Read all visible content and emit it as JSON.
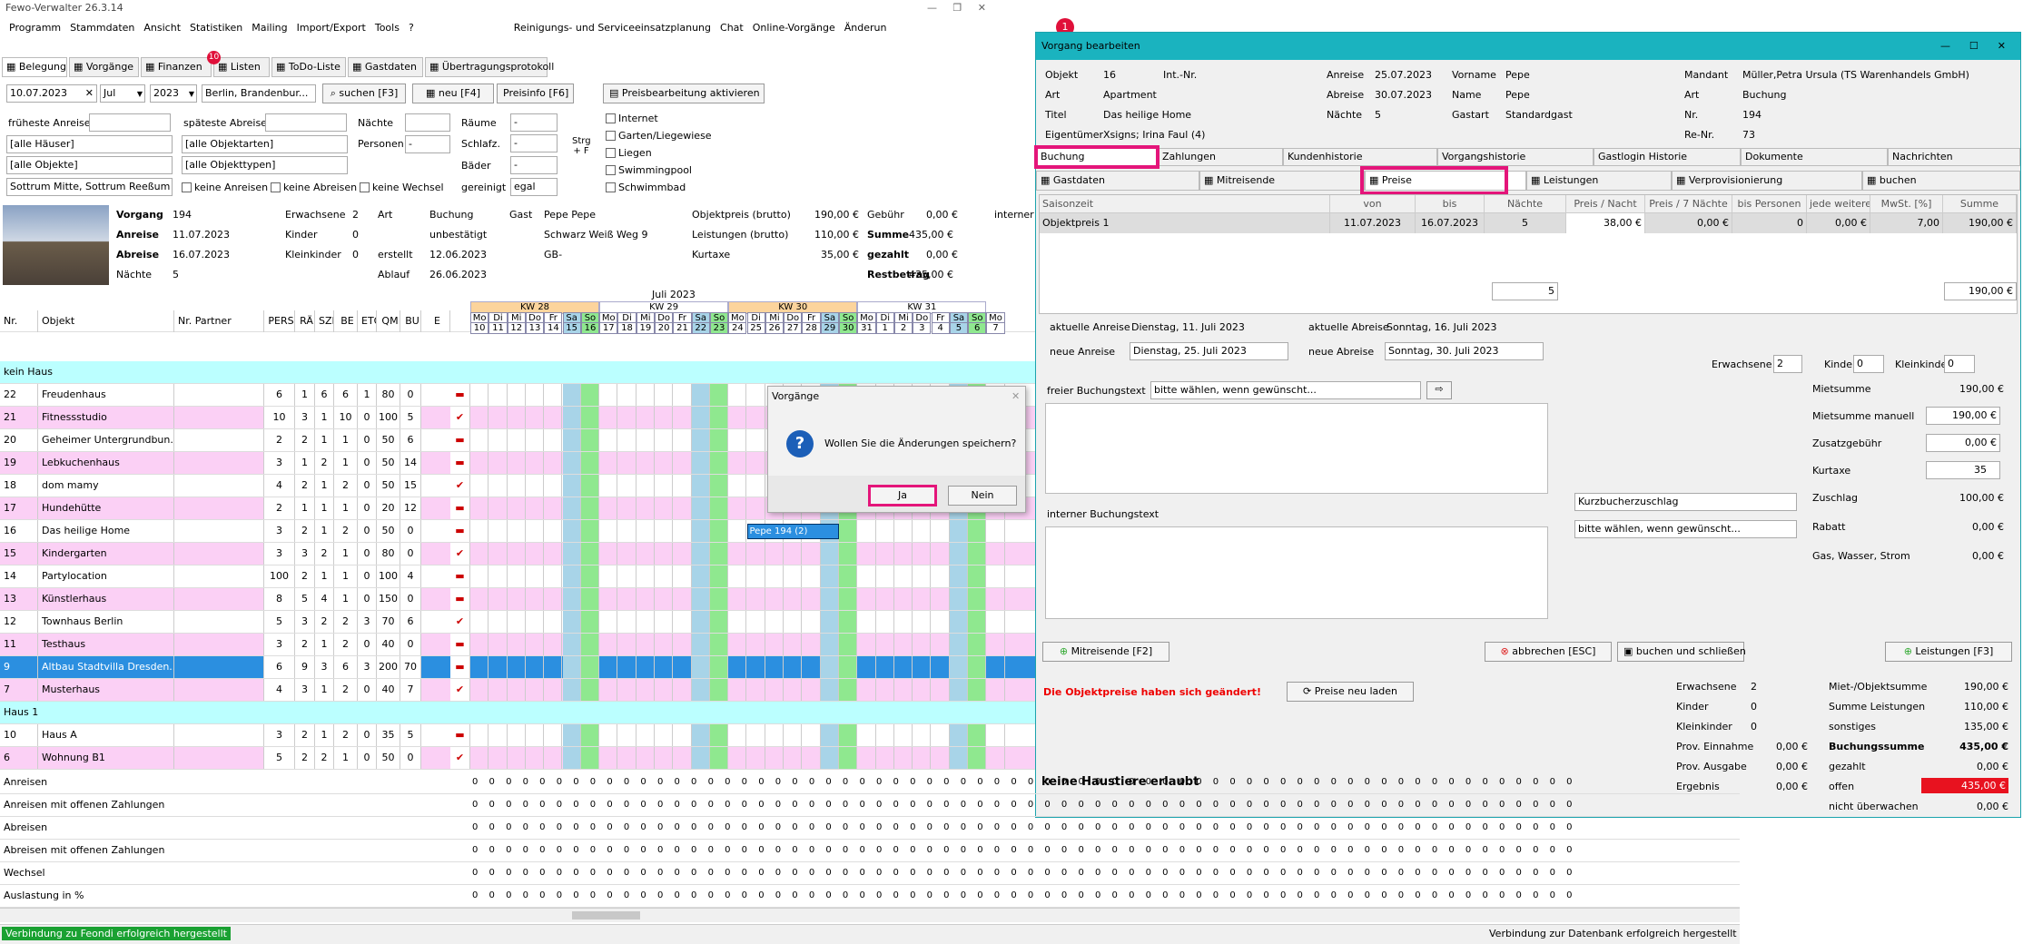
{
  "title": "Fewo-Verwalter 26.3.14",
  "menu": [
    "Programm",
    "Stammdaten",
    "Ansicht",
    "Statistiken",
    "Mailing",
    "Import/Export",
    "Tools",
    "?",
    "Reinigungs- und Serviceeinsatzplanung",
    "Chat",
    "Online-Vorgänge",
    "Änderun"
  ],
  "tabs": [
    "Belegung",
    "Vorgänge",
    "Finanzen",
    "Listen",
    "ToDo-Liste",
    "Gastdaten",
    "Übertragungsprotokoll"
  ],
  "badge_finanzen": "10",
  "badge_top": "1",
  "filter": {
    "date": "10.07.2023",
    "month": "Jul",
    "year": "2023",
    "region": "Berlin, Brandenbur...",
    "search": "suchen [F3]",
    "new": "neu [F4]",
    "preisinfo": "Preisinfo [F6]",
    "preisbearbeitung": "Preisbearbeitung aktivieren",
    "frueheste": "früheste Anreise",
    "spaeteste": "späteste Abreise",
    "naechte": "Nächte",
    "raeume": "Räume",
    "schlafz": "Schlafz.",
    "baeder": "Bäder",
    "personen": "Personen",
    "gereinigt": "gereinigt",
    "gereinigt_val": "egal",
    "strg": "Strg + F",
    "haeuser": "[alle Häuser]",
    "objektarten": "[alle Objektarten]",
    "objekte": "[alle Objekte]",
    "objekttypen": "[alle Objekttypen]",
    "ort": "Sottrum Mitte, Sottrum Reeßum",
    "keine_anreisen": "keine Anreisen",
    "keine_abreisen": "keine Abreisen",
    "keine_wechsel": "keine Wechsel",
    "features": [
      "Internet",
      "Garten/Liegewiese",
      "Liegen",
      "Swimmingpool",
      "Schwimmbad"
    ]
  },
  "info": {
    "vorgang_l": "Vorgang",
    "vorgang": "194",
    "anreise_l": "Anreise",
    "anreise": "11.07.2023",
    "abreise_l": "Abreise",
    "abreise": "16.07.2023",
    "naechte_l": "Nächte",
    "naechte": "5",
    "erw_l": "Erwachsene",
    "erw": "2",
    "kinder_l": "Kinder",
    "kinder": "0",
    "kk_l": "Kleinkinder",
    "kk": "0",
    "art_l": "Art",
    "art": "Buchung",
    "status": "unbestätigt",
    "erstellt_l": "erstellt",
    "erstellt": "12.06.2023",
    "ablauf_l": "Ablauf",
    "ablauf": "26.06.2023",
    "gast_l": "Gast",
    "gast": "Pepe  Pepe",
    "strasse": "Schwarz Weiß Weg 9",
    "land": "GB-",
    "objpreis_l": "Objektpreis (brutto)",
    "objpreis": "190,00 €",
    "leist_l": "Leistungen (brutto)",
    "leist": "110,00 €",
    "kurtaxe_l": "Kurtaxe",
    "kurtaxe": "35,00 €",
    "gebuehr_l": "Gebühr",
    "gebuehr": "0,00 €",
    "summe_l": "Summe",
    "summe": "435,00 €",
    "gezahlt_l": "gezahlt",
    "gezahlt": "0,00 €",
    "rest_l": "Restbetrag",
    "rest": "435,00 €",
    "intern": "interner B"
  },
  "grid_headers": [
    "Nr.",
    "Objekt",
    "Nr. Partner",
    "PERS",
    "RÄ",
    "SZI",
    "BE",
    "ETG",
    "QM",
    "BU",
    "E"
  ],
  "month_label": "Juli 2023",
  "weeks": [
    "KW 28",
    "KW 29",
    "KW 30",
    "KW 31"
  ],
  "weekdays": [
    "Mo",
    "Di",
    "Mi",
    "Do",
    "Fr",
    "Sa",
    "So",
    "Mo",
    "Di",
    "Mi",
    "Do",
    "Fr",
    "Sa",
    "So",
    "Mo",
    "Di",
    "Mi",
    "Do",
    "Fr",
    "Sa",
    "So",
    "Mo",
    "Di",
    "Mi",
    "Do",
    "Fr",
    "Sa",
    "So",
    "Mo"
  ],
  "days": [
    "10",
    "11",
    "12",
    "13",
    "14",
    "15",
    "16",
    "17",
    "18",
    "19",
    "20",
    "21",
    "22",
    "23",
    "24",
    "25",
    "26",
    "27",
    "28",
    "29",
    "30",
    "31",
    "1",
    "2",
    "3",
    "4",
    "5",
    "6",
    "7"
  ],
  "groups": [
    {
      "name": "kein Haus",
      "rows": [
        {
          "nr": "22",
          "obj": "Freudenhaus",
          "v": [
            "6",
            "1",
            "6",
            "6",
            "1",
            "80",
            "0"
          ],
          "pink": false
        },
        {
          "nr": "21",
          "obj": "Fitnessstudio",
          "v": [
            "10",
            "3",
            "1",
            "10",
            "0",
            "100",
            "5"
          ],
          "pink": true
        },
        {
          "nr": "20",
          "obj": "Geheimer Untergrundbun...",
          "v": [
            "2",
            "2",
            "1",
            "1",
            "0",
            "50",
            "6"
          ],
          "pink": false
        },
        {
          "nr": "19",
          "obj": "Lebkuchenhaus",
          "v": [
            "3",
            "1",
            "2",
            "1",
            "0",
            "50",
            "14"
          ],
          "pink": true
        },
        {
          "nr": "18",
          "obj": "dom mamy",
          "v": [
            "4",
            "2",
            "1",
            "2",
            "0",
            "50",
            "15"
          ],
          "pink": false
        },
        {
          "nr": "17",
          "obj": "Hundehütte",
          "v": [
            "2",
            "1",
            "1",
            "1",
            "0",
            "20",
            "12"
          ],
          "pink": true
        },
        {
          "nr": "16",
          "obj": "Das heilige Home",
          "v": [
            "3",
            "2",
            "1",
            "2",
            "0",
            "50",
            "0"
          ],
          "pink": false
        },
        {
          "nr": "15",
          "obj": "Kindergarten",
          "v": [
            "3",
            "3",
            "2",
            "1",
            "0",
            "80",
            "0"
          ],
          "pink": true
        },
        {
          "nr": "14",
          "obj": "Partylocation",
          "v": [
            "100",
            "2",
            "1",
            "1",
            "0",
            "100",
            "4"
          ],
          "pink": false
        },
        {
          "nr": "13",
          "obj": "Künstlerhaus",
          "v": [
            "8",
            "5",
            "4",
            "1",
            "0",
            "150",
            "0"
          ],
          "pink": true
        },
        {
          "nr": "12",
          "obj": "Townhaus Berlin",
          "v": [
            "5",
            "3",
            "2",
            "2",
            "3",
            "70",
            "6"
          ],
          "pink": false
        },
        {
          "nr": "11",
          "obj": "Testhaus",
          "v": [
            "3",
            "2",
            "1",
            "2",
            "0",
            "40",
            "0"
          ],
          "pink": true
        },
        {
          "nr": "9",
          "obj": "Altbau Stadtvilla Dresden...",
          "v": [
            "6",
            "9",
            "3",
            "6",
            "3",
            "200",
            "70"
          ],
          "pink": false,
          "sel": true
        },
        {
          "nr": "7",
          "obj": "Musterhaus",
          "v": [
            "4",
            "3",
            "1",
            "2",
            "0",
            "40",
            "7"
          ],
          "pink": true
        }
      ]
    },
    {
      "name": "Haus 1",
      "rows": [
        {
          "nr": "10",
          "obj": "Haus A",
          "v": [
            "3",
            "2",
            "1",
            "2",
            "0",
            "35",
            "5"
          ],
          "pink": false
        },
        {
          "nr": "6",
          "obj": "Wohnung B1",
          "v": [
            "5",
            "2",
            "2",
            "1",
            "0",
            "50",
            "0"
          ],
          "pink": true
        }
      ]
    }
  ],
  "booking_label": "Pepe  194 (2)",
  "bottom_rows": [
    "Anreisen",
    "Anreisen mit offenen Zahlungen",
    "Abreisen",
    "Abreisen mit offenen Zahlungen",
    "Wechsel",
    "Auslastung in %"
  ],
  "status_left": "Verbindung zu Feondi erfolgreich hergestellt",
  "status_right": "Verbindung zur Datenbank erfolgreich hergestellt",
  "dialog": {
    "title": "Vorgänge",
    "question": "Wollen Sie die Änderungen speichern?",
    "yes": "Ja",
    "no": "Nein"
  },
  "win": {
    "title": "Vorgang bearbeiten",
    "objekt_l": "Objekt",
    "objekt": "16",
    "intnr_l": "Int.-Nr.",
    "art_l": "Art",
    "art": "Apartment",
    "titel_l": "Titel",
    "titel": "Das heilige Home",
    "eig_l": "Eigentümer",
    "eig": "Xsigns; Irina Faul (4)",
    "anr_l": "Anreise",
    "anr": "25.07.2023",
    "abr_l": "Abreise",
    "abr": "30.07.2023",
    "n_l": "Nächte",
    "n": "5",
    "vorname_l": "Vorname",
    "vorname": "Pepe",
    "name_l": "Name",
    "name": "Pepe",
    "gastart_l": "Gastart",
    "gastart": "Standardgast",
    "mandant_l": "Mandant",
    "mandant": "Müller,Petra Ursula (TS Warenhandels GmbH)",
    "art2_l": "Art",
    "art2": "Buchung",
    "nr_l": "Nr.",
    "nr": "194",
    "renr_l": "Re-Nr.",
    "renr": "73",
    "tabs1": [
      "Buchung",
      "Zahlungen",
      "Kundenhistorie",
      "Vorgangshistorie",
      "Gastlogin Historie",
      "Dokumente",
      "Nachrichten"
    ],
    "tabs2": [
      "Gastdaten",
      "Mitreisende",
      "Preise",
      "Leistungen",
      "Verprovisionierung",
      "buchen"
    ],
    "cols": [
      "Saisonzeit",
      "von",
      "bis",
      "Nächte",
      "Preis / Nacht",
      "Preis / 7 Nächte",
      "bis Personen",
      "jede weitere",
      "MwSt. [%]",
      "Summe"
    ],
    "row": [
      "Objektpreis 1",
      "11.07.2023",
      "16.07.2023",
      "5",
      "38,00 €",
      "0,00 €",
      "0",
      "0,00 €",
      "7,00",
      "190,00 €"
    ],
    "tot_n": "5",
    "tot_sum": "190,00 €",
    "akt_anr_l": "aktuelle Anreise",
    "akt_anr": "Dienstag, 11. Juli 2023",
    "akt_abr_l": "aktuelle Abreise",
    "akt_abr": "Sonntag, 16. Juli 2023",
    "neu_anr_l": "neue Anreise",
    "neu_anr": "Dienstag, 25. Juli 2023",
    "neu_abr_l": "neue Abreise",
    "neu_abr": "Sonntag, 30. Juli 2023",
    "erw_l": "Erwachsene",
    "erw": "2",
    "kinder_l": "Kinder",
    "kinder": "0",
    "kk_l": "Kleinkinder",
    "kk": "0",
    "frei_l": "freier Buchungstext",
    "frei": "bitte wählen, wenn gewünscht...",
    "intern_l": "interner Buchungstext",
    "kurz": "Kurzbucherzuschlag",
    "bitte2": "bitte wählen, wenn gewünscht...",
    "mietsumme_l": "Mietsumme",
    "mietsumme": "190,00 €",
    "mm_l": "Mietsumme manuell",
    "mm": "190,00 €",
    "zus_l": "Zusatzgebühr",
    "zus": "0,00 €",
    "kt_l": "Kurtaxe",
    "kt": "35",
    "zuschlag_l": "Zuschlag",
    "zuschlag": "100,00 €",
    "rabatt_l": "Rabatt",
    "rabatt": "0,00 €",
    "gas_l": "Gas, Wasser, Strom",
    "gas": "0,00 €",
    "b_mit": "Mitreisende [F2]",
    "b_abb": "abbrechen [ESC]",
    "b_buch": "buchen und schließen",
    "b_leist": "Leistungen [F3]",
    "changed": "Die Objektpreise haben sich geändert!",
    "reload": "Preise neu laden",
    "s_erw_l": "Erwachsene",
    "s_erw": "2",
    "s_k_l": "Kinder",
    "s_k": "0",
    "s_kk_l": "Kleinkinder",
    "s_kk": "0",
    "pe_l": "Prov. Einnahme",
    "pe": "0,00 €",
    "pa_l": "Prov. Ausgabe",
    "pa": "0,00 €",
    "erg_l": "Ergebnis",
    "erg": "0,00 €",
    "mo_l": "Miet-/Objektsumme",
    "mo": "190,00 €",
    "sl_l": "Summe Leistungen",
    "sl": "110,00 €",
    "son_l": "sonstiges",
    "son": "135,00 €",
    "bs_l": "Buchungssumme",
    "bs": "435,00 €",
    "gez_l": "gezahlt",
    "gez": "0,00 €",
    "off_l": "offen",
    "off": "435,00 €",
    "nu_l": "nicht überwachen",
    "nu": "0,00 €",
    "pets": "keine Haustiere erlaubt"
  }
}
